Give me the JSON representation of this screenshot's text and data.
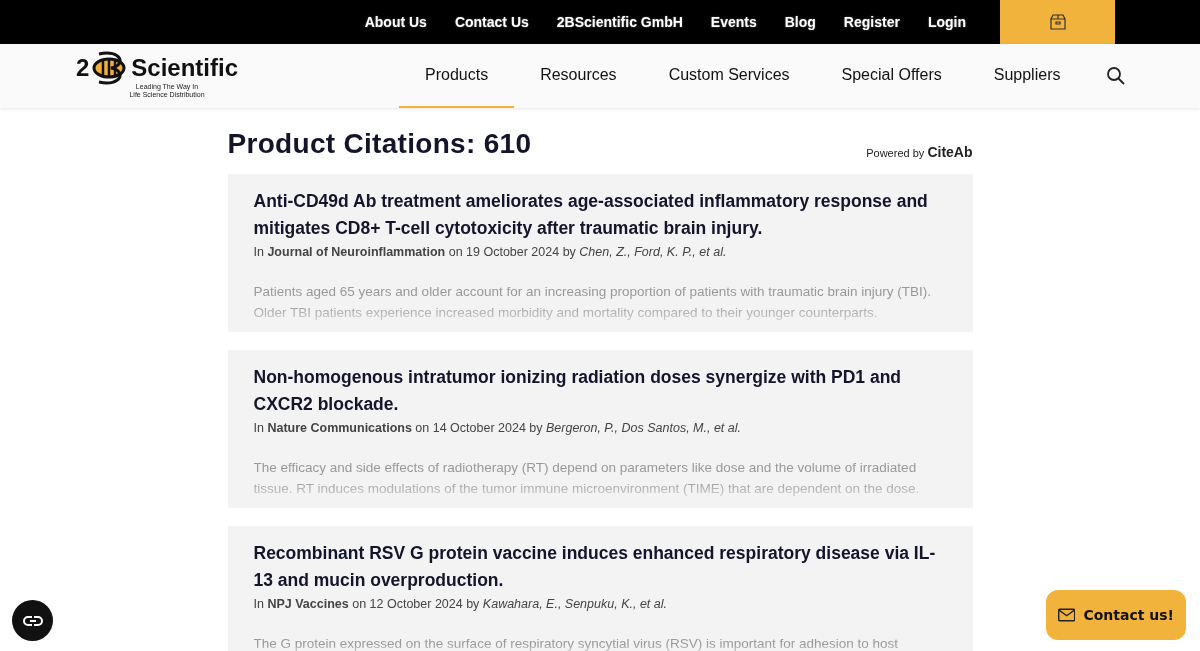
{
  "top_links": [
    "About Us",
    "Contact Us",
    "2BScientific GmbH",
    "Events",
    "Blog",
    "Register",
    "Login"
  ],
  "logo": {
    "prefix": "2",
    "name": "Scientific",
    "tagline": [
      "Leading The Way In",
      "Life Science Distribution"
    ]
  },
  "nav": [
    {
      "label": "Products",
      "selected": true
    },
    {
      "label": "Resources",
      "selected": false
    },
    {
      "label": "Custom Services",
      "selected": false
    },
    {
      "label": "Special Offers",
      "selected": false
    },
    {
      "label": "Suppliers",
      "selected": false
    }
  ],
  "heading": "Product Citations: 610",
  "powered_by": "Powered by **CiteAb**",
  "citations": [
    {
      "title": "Anti-CD49d Ab treatment ameliorates age-associated inflammatory response and mitigates CD8+ T-cell cytotoxicity after traumatic brain injury.",
      "meta": "In **Journal of Neuroinflammation** on 19 October 2024 by *Chen, Z., Ford, K. P., et al.*",
      "abstract": "Patients aged 65 years and older account for an increasing proportion of patients with traumatic brain injury (TBI). Older TBI patients experience increased morbidity and mortality compared to their younger counterparts."
    },
    {
      "title": "Non-homogenous intratumor ionizing radiation doses synergize with PD1 and CXCR2 blockade.",
      "meta": "In **Nature Communications** on 14 October 2024 by *Bergeron, P., Dos Santos, M., et al.*",
      "abstract": "The efficacy and side effects of radiotherapy (RT) depend on parameters like dose and the volume of irradiated tissue. RT induces modulations of the tumor immune microenvironment (TIME) that are dependent on the dose."
    },
    {
      "title": "Recombinant RSV G protein vaccine induces enhanced respiratory disease via IL-13 and mucin overproduction.",
      "meta": "In **NPJ Vaccines** on 12 October 2024 by *Kawahara, E., Senpuku, K., et al.*",
      "abstract": "The G protein expressed on the surface of respiratory syncytial virus (RSV) is important for adhesion to host"
    }
  ],
  "contact_button": "Contact us!"
}
